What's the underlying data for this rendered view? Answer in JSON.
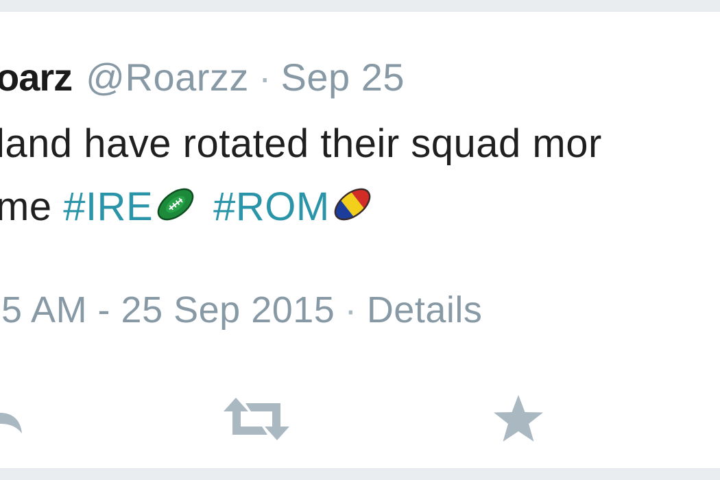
{
  "tweet": {
    "display_name": "oarz",
    "handle": "@Roarzz",
    "separator": "·",
    "date": "Sep 25",
    "text_line1": "land have rotated their squad mor",
    "text_line2_prefix": "me ",
    "hashtags": [
      {
        "text": "#IRE",
        "flag_icon": "rugby-ball-ireland-icon",
        "colors": [
          "#1c8a3a",
          "#0f5f26",
          "#ffffff"
        ]
      },
      {
        "text": "#ROM",
        "flag_icon": "rugby-ball-romania-icon",
        "colors": [
          "#1d3d9b",
          "#f2cf1a",
          "#d22c26"
        ]
      }
    ],
    "timestamp": "5 AM - 25 Sep 2015",
    "details_label": "Details"
  },
  "actions": {
    "reply_icon": "reply-icon",
    "retweet_icon": "retweet-icon",
    "favorite_icon": "star-icon",
    "icon_color": "#aab8c2"
  },
  "colors": {
    "hashtag": "#2a94a8",
    "meta_text": "#8899a6",
    "body_text": "#1f1f1f",
    "background": "#e9edf0",
    "card": "#ffffff"
  }
}
